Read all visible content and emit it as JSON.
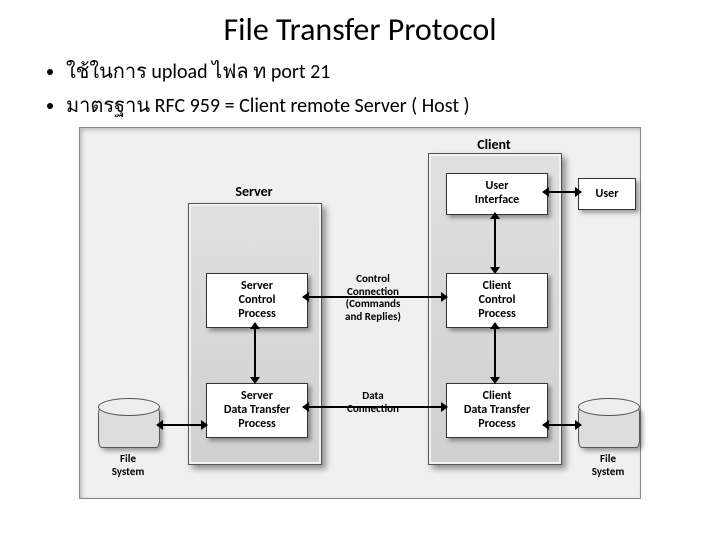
{
  "title": "File Transfer Protocol",
  "bullets": [
    "ใช้ในการ   upload ไฟล   ท     port 21",
    "มาตรฐาน RFC 959  = Client remote Server ( Host )"
  ],
  "labels": {
    "server": "Server",
    "client": "Client",
    "user": "User",
    "file_system": "File\nSystem"
  },
  "boxes": {
    "user_interface": "User\nInterface",
    "client_control_process": "Client\nControl\nProcess",
    "client_data_transfer_process": "Client\nData Transfer\nProcess",
    "server_control_process": "Server\nControl\nProcess",
    "server_data_transfer_process": "Server\nData Transfer\nProcess"
  },
  "connections": {
    "control": "Control\nConnection\n(Commands\nand Replies)",
    "data": "Data\nConnection"
  }
}
